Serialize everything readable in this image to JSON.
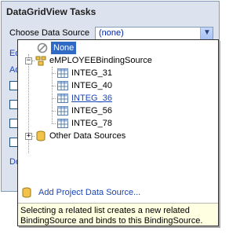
{
  "panel": {
    "title": "DataGridView Tasks",
    "choose_label": "Choose Data Source",
    "combo_value": "(none)",
    "partial_links": [
      "Ed",
      "Ad",
      "Do"
    ]
  },
  "tree": {
    "none_label": "None",
    "binding_source": "eMPLOYEEBindingSource",
    "children": [
      "INTEG_31",
      "INTEG_40",
      "INTEG_36",
      "INTEG_56",
      "INTEG_78"
    ],
    "other_sources": "Other Data Sources"
  },
  "footer": {
    "add_label": "Add Project Data Source...",
    "hint": "Selecting a related list creates a new related BindingSource and binds to this BindingSource."
  },
  "colors": {
    "selection": "#316ac5",
    "link": "#1a46b8",
    "panel_bg": "#dde3ee",
    "hint_bg": "#ffffe1"
  }
}
